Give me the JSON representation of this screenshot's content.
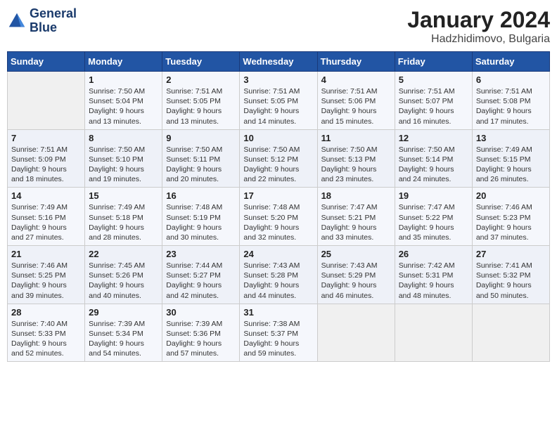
{
  "logo": {
    "line1": "General",
    "line2": "Blue"
  },
  "title": "January 2024",
  "subtitle": "Hadzhidimovo, Bulgaria",
  "days_of_week": [
    "Sunday",
    "Monday",
    "Tuesday",
    "Wednesday",
    "Thursday",
    "Friday",
    "Saturday"
  ],
  "weeks": [
    [
      {
        "day": "",
        "sunrise": "",
        "sunset": "",
        "daylight": ""
      },
      {
        "day": "1",
        "sunrise": "7:50 AM",
        "sunset": "5:04 PM",
        "daylight": "9 hours and 13 minutes."
      },
      {
        "day": "2",
        "sunrise": "7:51 AM",
        "sunset": "5:05 PM",
        "daylight": "9 hours and 13 minutes."
      },
      {
        "day": "3",
        "sunrise": "7:51 AM",
        "sunset": "5:05 PM",
        "daylight": "9 hours and 14 minutes."
      },
      {
        "day": "4",
        "sunrise": "7:51 AM",
        "sunset": "5:06 PM",
        "daylight": "9 hours and 15 minutes."
      },
      {
        "day": "5",
        "sunrise": "7:51 AM",
        "sunset": "5:07 PM",
        "daylight": "9 hours and 16 minutes."
      },
      {
        "day": "6",
        "sunrise": "7:51 AM",
        "sunset": "5:08 PM",
        "daylight": "9 hours and 17 minutes."
      }
    ],
    [
      {
        "day": "7",
        "sunrise": "7:51 AM",
        "sunset": "5:09 PM",
        "daylight": "9 hours and 18 minutes."
      },
      {
        "day": "8",
        "sunrise": "7:50 AM",
        "sunset": "5:10 PM",
        "daylight": "9 hours and 19 minutes."
      },
      {
        "day": "9",
        "sunrise": "7:50 AM",
        "sunset": "5:11 PM",
        "daylight": "9 hours and 20 minutes."
      },
      {
        "day": "10",
        "sunrise": "7:50 AM",
        "sunset": "5:12 PM",
        "daylight": "9 hours and 22 minutes."
      },
      {
        "day": "11",
        "sunrise": "7:50 AM",
        "sunset": "5:13 PM",
        "daylight": "9 hours and 23 minutes."
      },
      {
        "day": "12",
        "sunrise": "7:50 AM",
        "sunset": "5:14 PM",
        "daylight": "9 hours and 24 minutes."
      },
      {
        "day": "13",
        "sunrise": "7:49 AM",
        "sunset": "5:15 PM",
        "daylight": "9 hours and 26 minutes."
      }
    ],
    [
      {
        "day": "14",
        "sunrise": "7:49 AM",
        "sunset": "5:16 PM",
        "daylight": "9 hours and 27 minutes."
      },
      {
        "day": "15",
        "sunrise": "7:49 AM",
        "sunset": "5:18 PM",
        "daylight": "9 hours and 28 minutes."
      },
      {
        "day": "16",
        "sunrise": "7:48 AM",
        "sunset": "5:19 PM",
        "daylight": "9 hours and 30 minutes."
      },
      {
        "day": "17",
        "sunrise": "7:48 AM",
        "sunset": "5:20 PM",
        "daylight": "9 hours and 32 minutes."
      },
      {
        "day": "18",
        "sunrise": "7:47 AM",
        "sunset": "5:21 PM",
        "daylight": "9 hours and 33 minutes."
      },
      {
        "day": "19",
        "sunrise": "7:47 AM",
        "sunset": "5:22 PM",
        "daylight": "9 hours and 35 minutes."
      },
      {
        "day": "20",
        "sunrise": "7:46 AM",
        "sunset": "5:23 PM",
        "daylight": "9 hours and 37 minutes."
      }
    ],
    [
      {
        "day": "21",
        "sunrise": "7:46 AM",
        "sunset": "5:25 PM",
        "daylight": "9 hours and 39 minutes."
      },
      {
        "day": "22",
        "sunrise": "7:45 AM",
        "sunset": "5:26 PM",
        "daylight": "9 hours and 40 minutes."
      },
      {
        "day": "23",
        "sunrise": "7:44 AM",
        "sunset": "5:27 PM",
        "daylight": "9 hours and 42 minutes."
      },
      {
        "day": "24",
        "sunrise": "7:43 AM",
        "sunset": "5:28 PM",
        "daylight": "9 hours and 44 minutes."
      },
      {
        "day": "25",
        "sunrise": "7:43 AM",
        "sunset": "5:29 PM",
        "daylight": "9 hours and 46 minutes."
      },
      {
        "day": "26",
        "sunrise": "7:42 AM",
        "sunset": "5:31 PM",
        "daylight": "9 hours and 48 minutes."
      },
      {
        "day": "27",
        "sunrise": "7:41 AM",
        "sunset": "5:32 PM",
        "daylight": "9 hours and 50 minutes."
      }
    ],
    [
      {
        "day": "28",
        "sunrise": "7:40 AM",
        "sunset": "5:33 PM",
        "daylight": "9 hours and 52 minutes."
      },
      {
        "day": "29",
        "sunrise": "7:39 AM",
        "sunset": "5:34 PM",
        "daylight": "9 hours and 54 minutes."
      },
      {
        "day": "30",
        "sunrise": "7:39 AM",
        "sunset": "5:36 PM",
        "daylight": "9 hours and 57 minutes."
      },
      {
        "day": "31",
        "sunrise": "7:38 AM",
        "sunset": "5:37 PM",
        "daylight": "9 hours and 59 minutes."
      },
      {
        "day": "",
        "sunrise": "",
        "sunset": "",
        "daylight": ""
      },
      {
        "day": "",
        "sunrise": "",
        "sunset": "",
        "daylight": ""
      },
      {
        "day": "",
        "sunrise": "",
        "sunset": "",
        "daylight": ""
      }
    ]
  ]
}
